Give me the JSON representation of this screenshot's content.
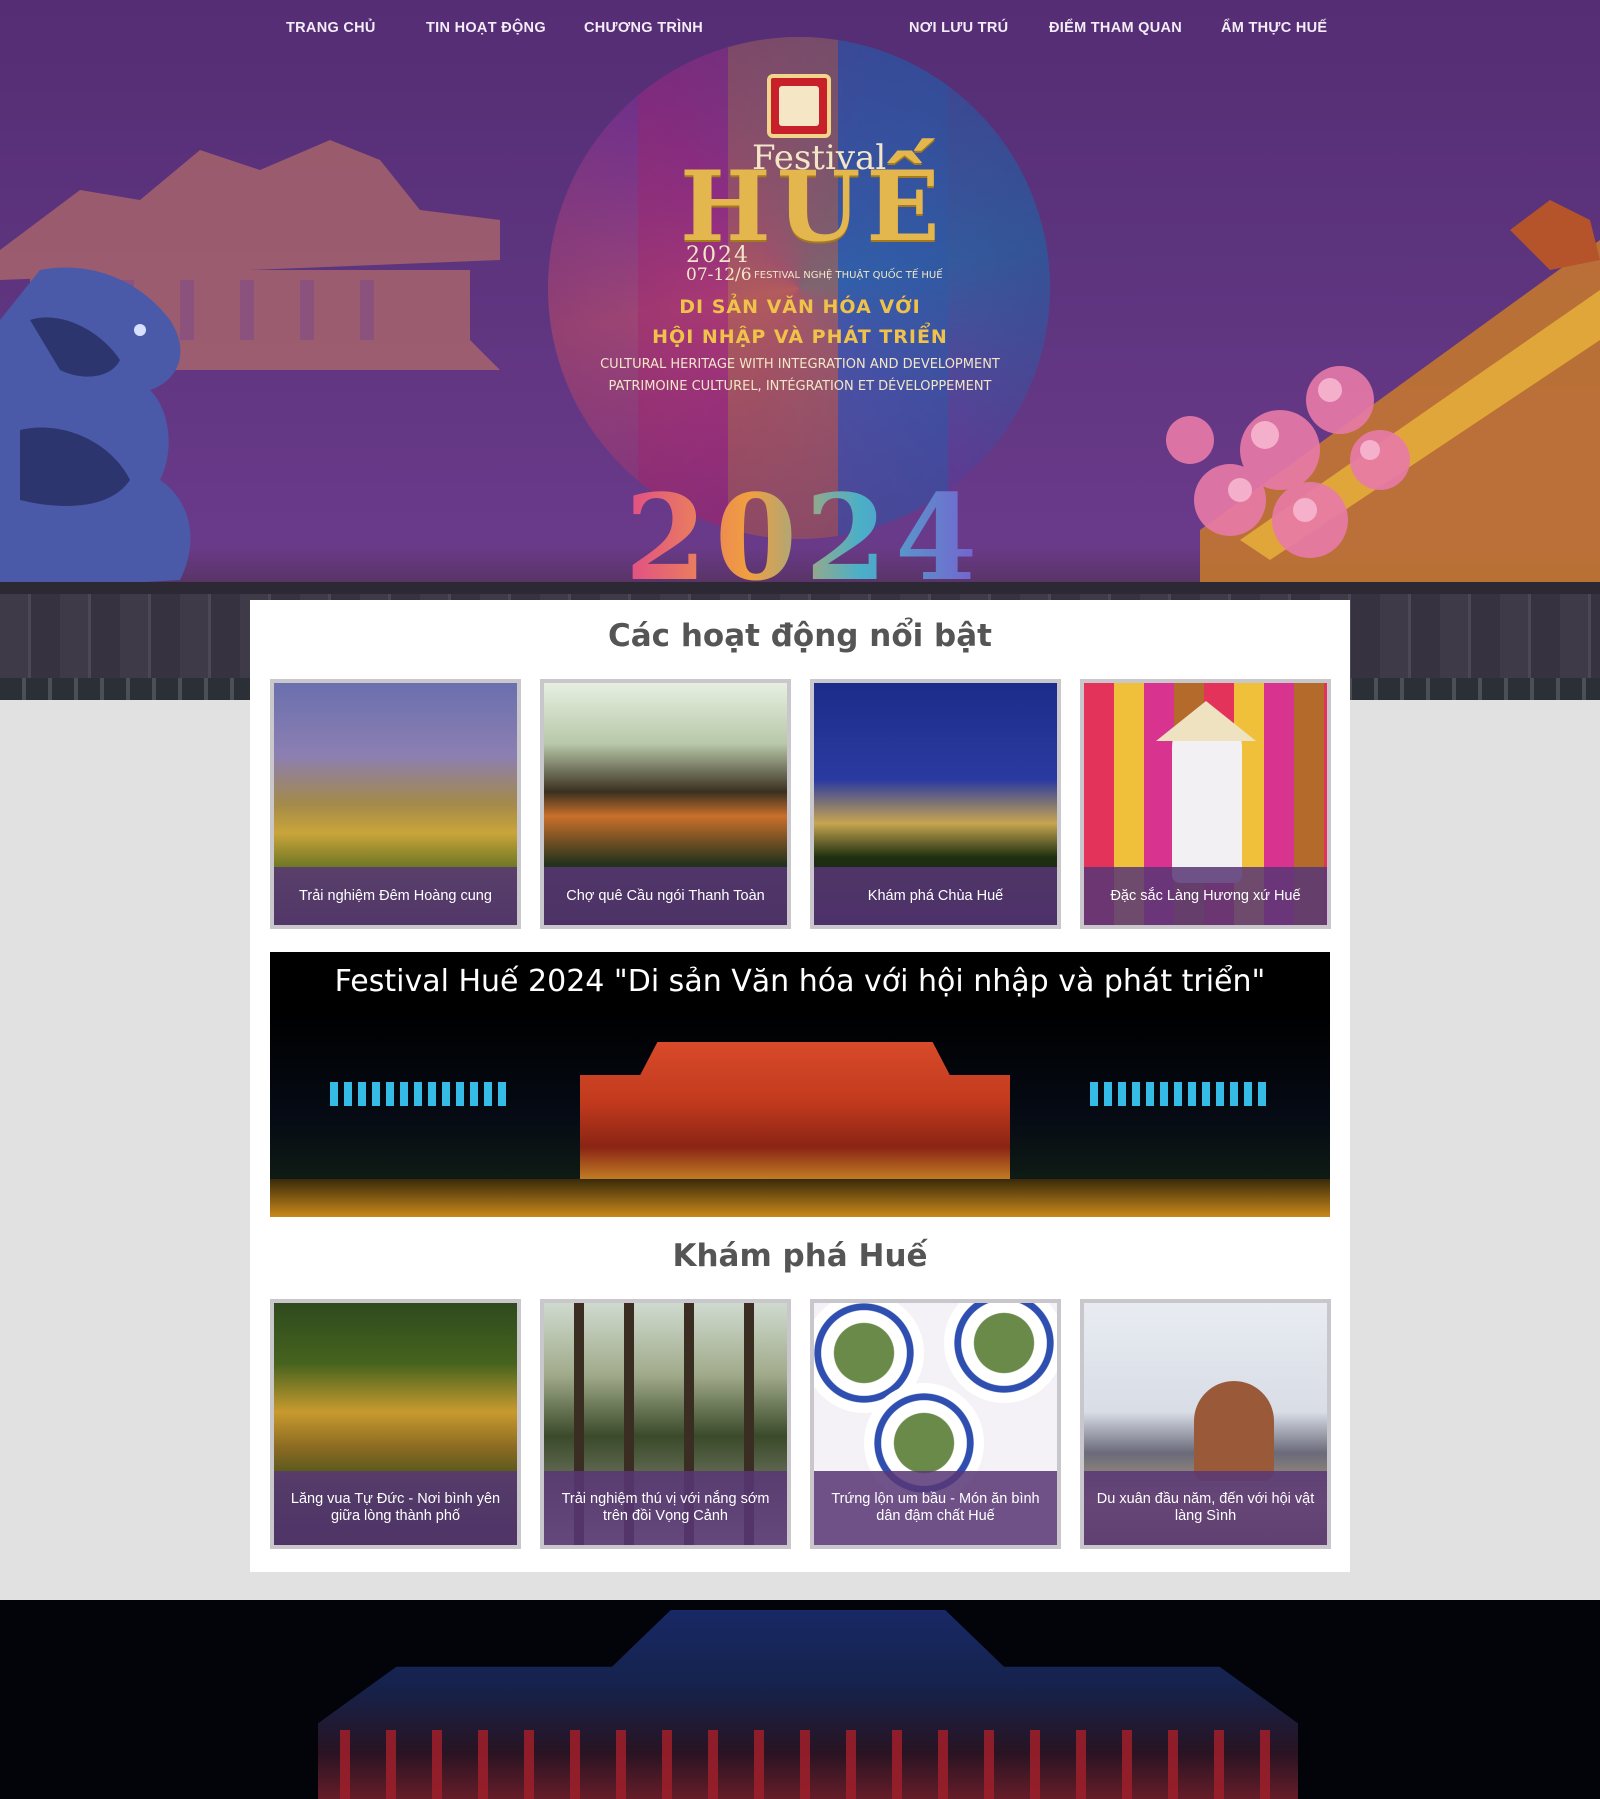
{
  "nav": {
    "items": [
      "TRANG CHỦ",
      "TIN HOẠT ĐỘNG",
      "CHƯƠNG TRÌNH",
      "NƠI LƯU TRÚ",
      "ĐIỂM THAM QUAN",
      "ẨM THỰC HUẾ"
    ]
  },
  "hero": {
    "festival_word": "Festival",
    "hue_word": "HUẾ",
    "year": "2024",
    "dates": "07-12/6",
    "subtitle": "FESTIVAL NGHỆ THUẬT QUỐC TẾ HUẾ",
    "theme_vi_line1": "DI SẢN VĂN HÓA VỚI",
    "theme_vi_line2": "HỘI NHẬP VÀ PHÁT TRIỂN",
    "theme_en": "CULTURAL HERITAGE WITH INTEGRATION AND DEVELOPMENT",
    "theme_fr": "PATRIMOINE CULTUREL, INTÉGRATION ET DÉVELOPPEMENT",
    "big_year": "2024"
  },
  "sections": {
    "highlights_title": "Các hoạt động nổi bật",
    "explore_title": "Khám phá Huế"
  },
  "highlights": [
    {
      "caption": "Trải nghiệm Đêm Hoàng cung"
    },
    {
      "caption": "Chợ quê Cầu ngói Thanh Toàn"
    },
    {
      "caption": "Khám phá Chùa Huế"
    },
    {
      "caption": "Đặc sắc Làng Hương xứ Huế"
    }
  ],
  "banner": {
    "title": "Festival Huế 2024 \"Di sản Văn hóa với hội nhập và phát triển\""
  },
  "explore": [
    {
      "caption": "Lăng vua Tự Đức - Nơi bình yên giữa lòng thành phố"
    },
    {
      "caption": "Trải nghiệm thú vị với nắng sớm trên đồi Vọng Cảnh"
    },
    {
      "caption": "Trứng lộn um bầu - Món ăn bình dân đậm chất Huế"
    },
    {
      "caption": "Du xuân đầu năm, đến với hội vật làng Sình"
    }
  ],
  "colors": {
    "hero_purple": "#5f3580",
    "caption_overlay": "#583776",
    "page_bg": "#e1e1e1",
    "title_gray": "#555555",
    "logo_gold": "#e4b64e"
  }
}
